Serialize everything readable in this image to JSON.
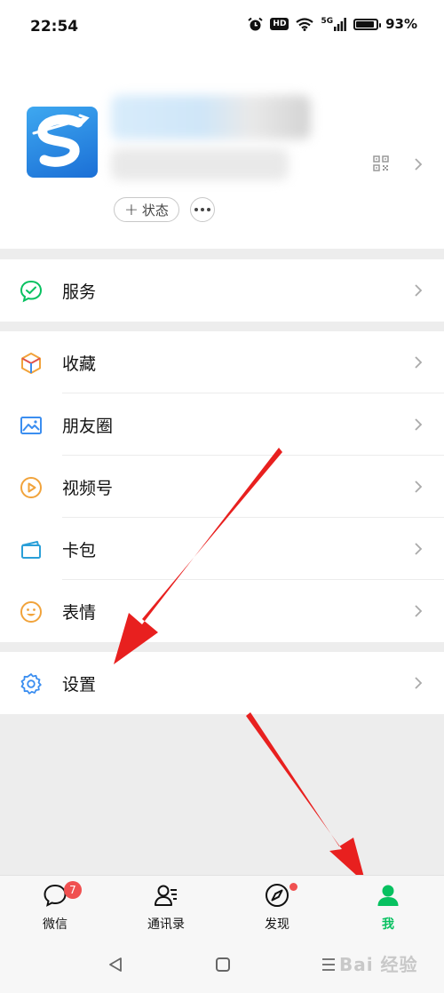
{
  "status_bar": {
    "time": "22:54",
    "hd": "HD",
    "network": "5G",
    "battery": "93%",
    "battery_level": 0.93
  },
  "profile": {
    "status_label": "状态"
  },
  "menu_groups": [
    [
      {
        "label": "服务",
        "icon": "service-icon"
      }
    ],
    [
      {
        "label": "收藏",
        "icon": "favorites-icon"
      },
      {
        "label": "朋友圈",
        "icon": "moments-icon"
      },
      {
        "label": "视频号",
        "icon": "channels-icon"
      },
      {
        "label": "卡包",
        "icon": "card-wallet-icon"
      },
      {
        "label": "表情",
        "icon": "sticker-icon"
      }
    ],
    [
      {
        "label": "设置",
        "icon": "settings-icon"
      }
    ]
  ],
  "tabbar": {
    "tabs": [
      {
        "label": "微信",
        "icon": "chats-icon",
        "badge": "7"
      },
      {
        "label": "通讯录",
        "icon": "contacts-icon"
      },
      {
        "label": "发现",
        "icon": "discover-icon"
      },
      {
        "label": "我",
        "icon": "me-icon"
      }
    ],
    "active_color": "#07c160"
  },
  "watermark": "Bai 经验",
  "colors": {
    "accent": "#07c160",
    "badge": "#f05050",
    "arrow": "#e8201f"
  }
}
